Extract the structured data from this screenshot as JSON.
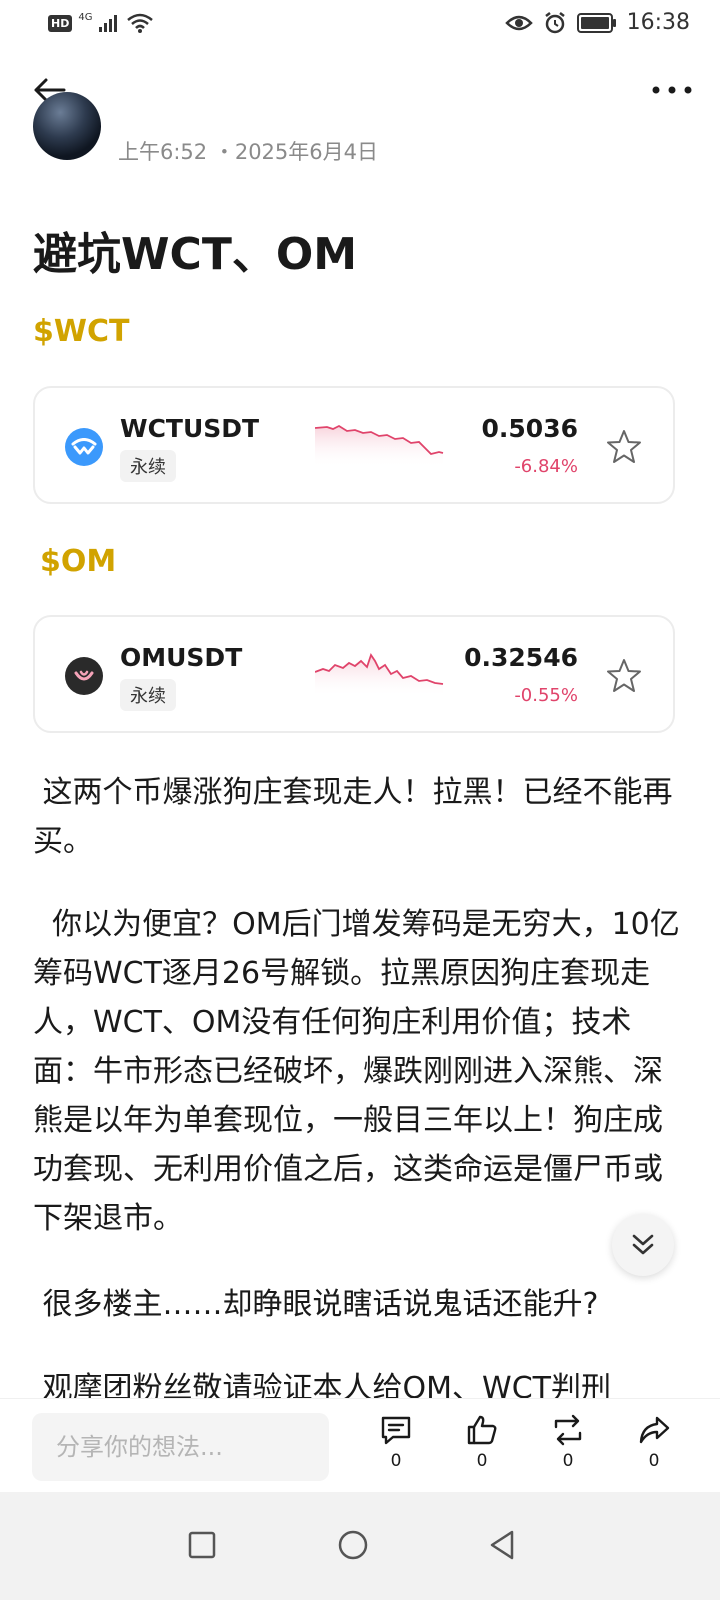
{
  "status_bar": {
    "hd": "HD",
    "network": "4G",
    "time": "16:38"
  },
  "post": {
    "meta": "上午6:52 ・2025年6月4日",
    "title": "避坑WCT、OM"
  },
  "tickers": [
    {
      "tag": "$WCT",
      "symbol": "WCTUSDT",
      "badge": "永续",
      "price": "0.5036",
      "change": "-6.84%",
      "icon": "walletconnect-icon",
      "icon_color": "#3b99fc"
    },
    {
      "tag": "$OM",
      "symbol": "OMUSDT",
      "badge": "永续",
      "price": "0.32546",
      "change": "-0.55%",
      "icon": "mantra-icon",
      "icon_color": "#2a2a2a"
    }
  ],
  "paragraphs": [
    " 这两个币爆涨狗庄套现走人！拉黑！已经不能再买。",
    "  你以为便宜？OM后门增发筹码是无穷大，10亿筹码WCT逐月26号解锁。拉黑原因狗庄套现走人，WCT、OM没有任何狗庄利用价值；技术面：牛市形态已经破坏，爆跌刚刚进入深熊、深熊是以年为单套现位，一般目三年以上！狗庄成功套现、无利用价值之后，这类命运是僵尸币或下架退市。",
    " 很多楼主……却睁眼说瞎话说鬼话还能升?",
    " 观摩团粉丝敬请验证本人给OM、WCT判刑"
  ],
  "action_bar": {
    "input_placeholder": "分享你的想法...",
    "comment_count": "0",
    "like_count": "0",
    "repost_count": "0",
    "share_count": "0"
  },
  "colors": {
    "accent_tag": "#d1a300",
    "negative": "#e0446b"
  }
}
